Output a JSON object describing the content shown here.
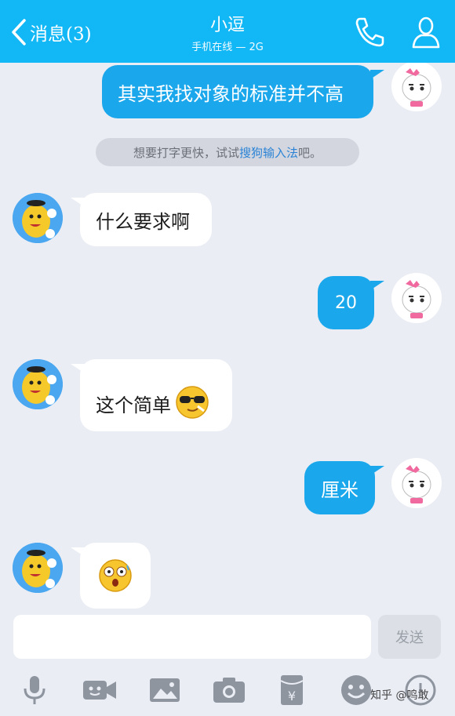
{
  "header": {
    "back_label": "消息(3)",
    "title": "小逗",
    "status": "手机在线 — 2G"
  },
  "messages": [
    {
      "side": "out",
      "text": "其实我找对象的标准并不高"
    },
    {
      "side": "system",
      "text_before": "想要打字更快，试试",
      "link": "搜狗输入法",
      "text_after": "吧。"
    },
    {
      "side": "in",
      "text": "什么要求啊"
    },
    {
      "side": "out",
      "text": "20"
    },
    {
      "side": "in",
      "text": "这个简单",
      "emoji": "cool-sunglasses-emoji"
    },
    {
      "side": "out",
      "text": "厘米"
    },
    {
      "side": "in",
      "emoji": "shocked-emoji"
    }
  ],
  "input": {
    "placeholder": "",
    "send_label": "发送"
  },
  "toolbar": [
    "mic-icon",
    "video-icon",
    "image-icon",
    "camera-icon",
    "red-packet-icon",
    "emoji-icon",
    "more-icon"
  ],
  "watermark": "知乎 @鸣敢",
  "colors": {
    "header": "#12b7f5",
    "bubble_out": "#1aa7ec",
    "background": "#eaedf4"
  }
}
